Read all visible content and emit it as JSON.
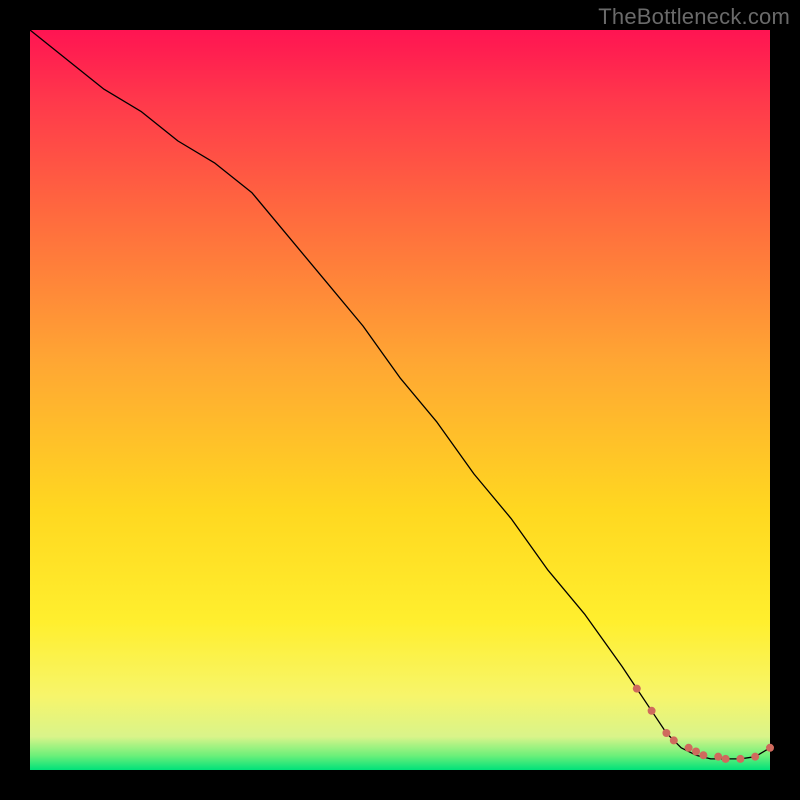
{
  "watermark": "TheBottleneck.com",
  "chart_data": {
    "type": "line",
    "title": "",
    "xlabel": "",
    "ylabel": "",
    "xlim": [
      0,
      100
    ],
    "ylim": [
      0,
      100
    ],
    "gradient": [
      {
        "pos": 0.0,
        "color": "#00e27a"
      },
      {
        "pos": 0.02,
        "color": "#6ff07a"
      },
      {
        "pos": 0.045,
        "color": "#d9f48a"
      },
      {
        "pos": 0.1,
        "color": "#f7f56b"
      },
      {
        "pos": 0.2,
        "color": "#ffef2e"
      },
      {
        "pos": 0.35,
        "color": "#ffd820"
      },
      {
        "pos": 0.55,
        "color": "#ffa733"
      },
      {
        "pos": 0.75,
        "color": "#ff6a3e"
      },
      {
        "pos": 0.9,
        "color": "#ff3a4b"
      },
      {
        "pos": 1.0,
        "color": "#ff1452"
      }
    ],
    "series": [
      {
        "name": "bottleneck-curve",
        "x": [
          0,
          5,
          10,
          15,
          20,
          25,
          30,
          35,
          40,
          45,
          50,
          55,
          60,
          65,
          70,
          75,
          80,
          82,
          84,
          86,
          88,
          90,
          92,
          94,
          96,
          98,
          100
        ],
        "y": [
          100,
          96,
          92,
          89,
          85,
          82,
          78,
          72,
          66,
          60,
          53,
          47,
          40,
          34,
          27,
          21,
          14,
          11,
          8,
          5,
          3,
          2,
          1.5,
          1.5,
          1.5,
          1.8,
          3
        ]
      }
    ],
    "markers": {
      "name": "highlight-points",
      "x": [
        82,
        84,
        86,
        87,
        89,
        90,
        91,
        93,
        94,
        96,
        98,
        100
      ],
      "y": [
        11,
        8,
        5,
        4,
        3,
        2.5,
        2,
        1.8,
        1.5,
        1.5,
        1.8,
        3
      ]
    },
    "marker_color": "#cf6a5d",
    "line_color": "#000000"
  }
}
